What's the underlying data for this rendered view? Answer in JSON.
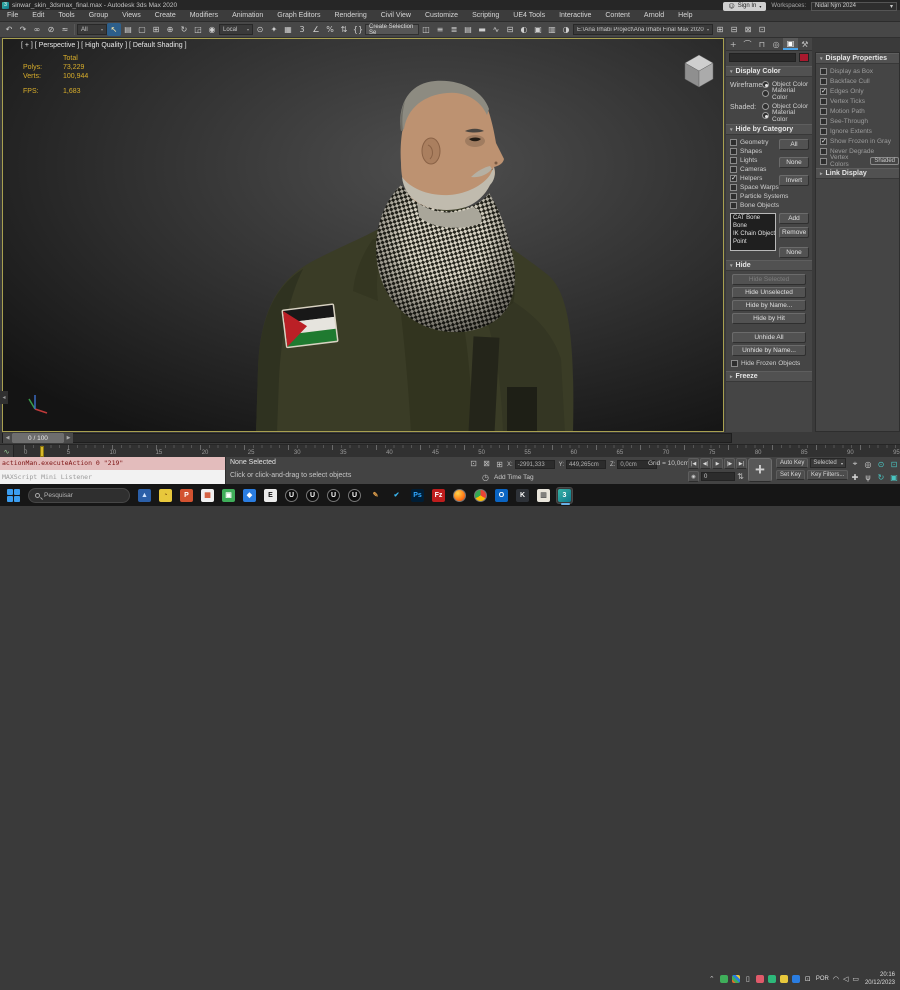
{
  "window": {
    "title": "sinwar_skin_3dsmax_final.max - Autodesk 3ds Max 2020",
    "app_glyph": "3",
    "minimize_glyph": "—",
    "maximize_glyph": "▢",
    "close_glyph": "✕"
  },
  "menubar": {
    "items": [
      "File",
      "Edit",
      "Tools",
      "Group",
      "Views",
      "Create",
      "Modifiers",
      "Animation",
      "Graph Editors",
      "Rendering",
      "Civil View",
      "Customize",
      "Scripting",
      "UE4 Tools",
      "Interactive",
      "Content",
      "Arnold",
      "Help"
    ],
    "sign_in": "Sign In",
    "workspaces_label": "Workspaces:",
    "workspace_value": "Nidal Njm 2024"
  },
  "toolbar": {
    "strip_a": [
      {
        "name": "undo-icon",
        "glyph": "↶"
      },
      {
        "name": "redo-icon",
        "glyph": "↷"
      },
      {
        "name": "select-and-link-icon",
        "glyph": "∞"
      },
      {
        "name": "unlink-selection-icon",
        "glyph": "⊘"
      },
      {
        "name": "bind-to-space-warp-icon",
        "glyph": "≈"
      }
    ],
    "filter_value": "All",
    "strip_b": [
      {
        "name": "select-object-icon",
        "glyph": "↖",
        "active": true
      },
      {
        "name": "select-by-name-icon",
        "glyph": "▤"
      },
      {
        "name": "rectangular-selection-region-icon",
        "glyph": "▢"
      },
      {
        "name": "window-crossing-icon",
        "glyph": "⊞"
      },
      {
        "name": "select-and-move-icon",
        "glyph": "⊕"
      },
      {
        "name": "select-and-rotate-icon",
        "glyph": "↻"
      },
      {
        "name": "select-and-scale-icon",
        "glyph": "◲"
      },
      {
        "name": "select-and-place-icon",
        "glyph": "◉"
      }
    ],
    "coord_value": "Local",
    "strip_c": [
      {
        "name": "use-pivot-point-icon",
        "glyph": "⊙"
      },
      {
        "name": "select-and-manipulate-icon",
        "glyph": "✦"
      },
      {
        "name": "keyboard-shortcut-override-icon",
        "glyph": "▦"
      },
      {
        "name": "snap-toggle-3d-icon",
        "glyph": "3"
      },
      {
        "name": "angle-snap-icon",
        "glyph": "∠"
      },
      {
        "name": "percent-snap-icon",
        "glyph": "%"
      },
      {
        "name": "spinner-snap-icon",
        "glyph": "⇅"
      },
      {
        "name": "edit-named-selection-sets-icon",
        "glyph": "{}"
      }
    ],
    "selection_set_value": "Create Selection Se",
    "strip_d": [
      {
        "name": "mirror-icon",
        "glyph": "◫"
      },
      {
        "name": "align-icon",
        "glyph": "≡"
      },
      {
        "name": "layer-manager-icon",
        "glyph": "≣"
      },
      {
        "name": "toggle-layer-explorer-icon",
        "glyph": "▤"
      },
      {
        "name": "toggle-ribbon-icon",
        "glyph": "▬"
      },
      {
        "name": "curve-editor-icon",
        "glyph": "∿"
      },
      {
        "name": "schematic-view-icon",
        "glyph": "⊟"
      },
      {
        "name": "material-editor-icon",
        "glyph": "◐"
      },
      {
        "name": "render-setup-icon",
        "glyph": "▣"
      },
      {
        "name": "rendered-frame-window-icon",
        "glyph": "▥"
      },
      {
        "name": "render-production-icon",
        "glyph": "◑"
      }
    ],
    "project_path": "E:\\Ana Irhabi Project\\Ana Irhabi Final Max 2020",
    "strip_e": [
      {
        "name": "scene-tool-icon-1",
        "glyph": "⊞"
      },
      {
        "name": "scene-tool-icon-2",
        "glyph": "⊟"
      },
      {
        "name": "scene-tool-icon-3",
        "glyph": "⊠"
      },
      {
        "name": "scene-tool-icon-4",
        "glyph": "⊡"
      }
    ]
  },
  "viewport": {
    "label": "[ + ] [ Perspective ] [ High Quality ] [ Default Shading ]",
    "total_label": "Total",
    "polys_label": "Polys:",
    "polys_value": "73,229",
    "verts_label": "Verts:",
    "verts_value": "100,944",
    "fps_label": "FPS:",
    "fps_value": "1,683"
  },
  "command_panel": {
    "tabs": [
      {
        "name": "create-tab",
        "glyph": "+"
      },
      {
        "name": "modify-tab",
        "glyph": "⌒"
      },
      {
        "name": "hierarchy-tab",
        "glyph": "⊓"
      },
      {
        "name": "motion-tab",
        "glyph": "◎"
      },
      {
        "name": "display-tab",
        "glyph": "▣",
        "active": true
      },
      {
        "name": "utilities-tab",
        "glyph": "⚒"
      }
    ],
    "object_name_value": "",
    "color_swatch": "#a8192e",
    "display_color": {
      "title": "Display Color",
      "rows": [
        {
          "label": "Wireframe:",
          "opt1": "Object Color",
          "opt1_on": true,
          "opt2": "Material Color",
          "opt2_on": false
        },
        {
          "label": "Shaded:",
          "opt1": "Object Color",
          "opt1_on": false,
          "opt2": "Material Color",
          "opt2_on": true
        }
      ]
    },
    "hide_by_category": {
      "title": "Hide by Category",
      "categories": [
        {
          "label": "Geometry",
          "checked": false
        },
        {
          "label": "Shapes",
          "checked": false
        },
        {
          "label": "Lights",
          "checked": false
        },
        {
          "label": "Cameras",
          "checked": false
        },
        {
          "label": "Helpers",
          "checked": true
        },
        {
          "label": "Space Warps",
          "checked": false
        },
        {
          "label": "Particle Systems",
          "checked": false
        },
        {
          "label": "Bone Objects",
          "checked": false
        }
      ],
      "quick_buttons": [
        "All",
        "None",
        "Invert"
      ],
      "list_items": [
        "CAT Bone",
        "Bone",
        "IK Chain Object",
        "Point"
      ],
      "list_buttons": [
        "Add",
        "Remove",
        "None"
      ]
    },
    "hide": {
      "title": "Hide",
      "buttons": [
        {
          "label": "Hide Selected",
          "disabled": true
        },
        {
          "label": "Hide Unselected"
        },
        {
          "label": "Hide by Name..."
        },
        {
          "label": "Hide by Hit"
        },
        {
          "label": "Unhide All",
          "gap": true
        },
        {
          "label": "Unhide by Name..."
        }
      ],
      "checkbox_label": "Hide Frozen Objects",
      "checkbox_checked": false
    },
    "freeze_title": "Freeze"
  },
  "display_properties": {
    "title": "Display Properties",
    "items": [
      {
        "label": "Display as Box",
        "checked": false
      },
      {
        "label": "Backface Cull",
        "checked": false
      },
      {
        "label": "Edges Only",
        "checked": true
      },
      {
        "label": "Vertex Ticks",
        "checked": false
      },
      {
        "label": "Motion Path",
        "checked": false
      },
      {
        "label": "See-Through",
        "checked": false
      },
      {
        "label": "Ignore Extents",
        "checked": false
      },
      {
        "label": "Show Frozen in Gray",
        "checked": true
      },
      {
        "label": "Never Degrade",
        "checked": false
      },
      {
        "label": "Vertex Colors",
        "checked": false,
        "button": "Shaded"
      }
    ],
    "link_display_title": "Link Display"
  },
  "timeline": {
    "slider_value": "0 / 100",
    "prev_glyph": "◀",
    "next_glyph": "▶",
    "curve_editor_glyph": "∿",
    "tick_labels": [
      "0",
      "5",
      "10",
      "15",
      "20",
      "25",
      "30",
      "35",
      "40",
      "45",
      "50",
      "55",
      "60",
      "65",
      "70",
      "75",
      "80",
      "85",
      "90",
      "95"
    ]
  },
  "statusbar": {
    "maxscript_line": "actionMan.executeAction 0 \"219\"",
    "listener_label": "MAXScript Mini Listener",
    "selection_status": "None Selected",
    "prompt": "Click or click-and-drag to select objects",
    "toggles": [
      {
        "name": "isolate-selection-toggle",
        "glyph": "⊡"
      },
      {
        "name": "selection-lock-toggle",
        "glyph": "⊠"
      }
    ],
    "coord_icon_glyph": "⊞",
    "coords": [
      {
        "label": "X:",
        "value": "-2991,333"
      },
      {
        "label": "Y:",
        "value": "449,265cm"
      },
      {
        "label": "Z:",
        "value": "0,0cm"
      }
    ],
    "grid_label": "Grid = 10,0cm",
    "time_tag_icon_glyph": "◷",
    "add_time_tag": "Add Time Tag",
    "playback": [
      {
        "name": "go-to-start-button",
        "glyph": "|◀"
      },
      {
        "name": "previous-frame-button",
        "glyph": "◀|"
      },
      {
        "name": "play-button",
        "glyph": "▶"
      },
      {
        "name": "next-frame-button",
        "glyph": "|▶"
      },
      {
        "name": "go-to-end-button",
        "glyph": "▶|"
      }
    ],
    "key_mode_glyph": "◉",
    "frame_value": "0",
    "spinner_glyph": "⇅",
    "key_icon_glyph": "⚷",
    "bigkey_glyph": "+",
    "auto_key": "Auto Key",
    "selected_dd": "Selected",
    "set_key": "Set Key",
    "key_filters": "Key Filters...",
    "nav_icons": [
      {
        "name": "zoom-button",
        "glyph": "⌖"
      },
      {
        "name": "zoom-all-button",
        "glyph": "◎"
      },
      {
        "name": "zoom-extents-button",
        "glyph": "⊙",
        "fg": "#49c6c2"
      },
      {
        "name": "zoom-region-button",
        "glyph": "⊡",
        "fg": "#49c6c2"
      },
      {
        "name": "pan-button",
        "glyph": "✚"
      },
      {
        "name": "walk-through-button",
        "glyph": "ψ"
      },
      {
        "name": "orbit-button",
        "glyph": "↻",
        "fg": "#49c6c2"
      },
      {
        "name": "maximize-viewport-button",
        "glyph": "▣",
        "fg": "#49c6c2"
      }
    ]
  },
  "taskbar": {
    "search_placeholder": "Pesquisar",
    "apps": [
      {
        "name": "photos-app-icon",
        "glyph": "▲",
        "bg": "#2b5fa8",
        "fg": "#cfe3ff"
      },
      {
        "name": "paint-app-icon",
        "glyph": "◔",
        "bg": "#e8c83c",
        "fg": "#8a5a10"
      },
      {
        "name": "powerpoint-app-icon",
        "glyph": "P",
        "bg": "#d35230",
        "fg": "#ffffff"
      },
      {
        "name": "office-tiles-app-icon",
        "glyph": "▦",
        "bg": "#f0f0f0",
        "fg": "#d35230"
      },
      {
        "name": "gallery-app-icon",
        "glyph": "▣",
        "bg": "#3fae5a",
        "fg": "#ffffff"
      },
      {
        "name": "hexagon-app-icon",
        "glyph": "◆",
        "bg": "#2a7de1",
        "fg": "#ffffff"
      },
      {
        "name": "epic-games-icon",
        "glyph": "E",
        "bg": "#ececec",
        "fg": "#111111"
      },
      {
        "name": "unreal-engine-icon",
        "glyph": "U",
        "bg": "#0d0d0d",
        "fg": "#ffffff",
        "round": true
      },
      {
        "name": "unreal-engine-icon",
        "glyph": "U",
        "bg": "#0d0d0d",
        "fg": "#ffffff",
        "round": true
      },
      {
        "name": "unreal-engine-icon",
        "glyph": "U",
        "bg": "#0d0d0d",
        "fg": "#ffffff",
        "round": true
      },
      {
        "name": "unreal-engine-icon",
        "glyph": "U",
        "bg": "#0d0d0d",
        "fg": "#ffffff",
        "round": true
      },
      {
        "name": "pen-tool-icon",
        "glyph": "✎",
        "bg": "transparent",
        "fg": "#d89a4a"
      },
      {
        "name": "check-app-icon",
        "glyph": "✔",
        "bg": "transparent",
        "fg": "#3ab6f0"
      },
      {
        "name": "photoshop-icon",
        "glyph": "Ps",
        "bg": "#001e36",
        "fg": "#31a8ff"
      },
      {
        "name": "filezilla-icon",
        "glyph": "Fz",
        "bg": "#bf1d1d",
        "fg": "#ffffff"
      },
      {
        "name": "firefox-icon",
        "glyph": "",
        "bg": "radial-gradient(circle at 35% 30%,#ffd54a,#ff7a18 60%,#e0390b)",
        "fg": "#ffffff",
        "round": true
      },
      {
        "name": "chrome-icon",
        "glyph": "",
        "bg": "conic-gradient(#ea4335 0deg 120deg,#fbbc05 120deg 240deg,#34a853 240deg 360deg)",
        "fg": "#ffffff",
        "round": true
      },
      {
        "name": "outlook-icon",
        "glyph": "O",
        "bg": "#0a64c2",
        "fg": "#ffffff"
      },
      {
        "name": "krita-app-icon",
        "glyph": "K",
        "bg": "#2e3238",
        "fg": "#ffffff"
      },
      {
        "name": "notes-app-icon",
        "glyph": "▥",
        "bg": "#e8e4da",
        "fg": "#555555"
      },
      {
        "name": "3dsmax-icon",
        "glyph": "3",
        "bg": "linear-gradient(135deg,#38b2a5,#0f7a8d)",
        "fg": "#ffffff",
        "active": true
      }
    ],
    "tray": [
      {
        "name": "tray-chevron-icon",
        "glyph": "⌃",
        "fg": "#cccccc"
      },
      {
        "name": "tray-green-app-icon",
        "glyph": "",
        "bg": "#3fae5a"
      },
      {
        "name": "tray-mosaic-app-icon",
        "glyph": "",
        "bg": "linear-gradient(45deg,#e06a2a 0 25%,#3fae5a 0 50%,#2a7de1 0 75%,#e8c83c 0)"
      },
      {
        "name": "phone-link-icon",
        "glyph": "▯",
        "fg": "#dddddd"
      },
      {
        "name": "tray-red-app-icon",
        "glyph": "",
        "bg": "#e05a6a"
      },
      {
        "name": "tray-sync-app-icon",
        "glyph": "",
        "bg": "#2db87a"
      },
      {
        "name": "tray-yellow-app-icon",
        "glyph": "",
        "bg": "#e8c83c"
      },
      {
        "name": "bluetooth-icon",
        "glyph": "",
        "bg": "#2a7de1"
      },
      {
        "name": "display-device-icon",
        "glyph": "⊡",
        "fg": "#dddddd"
      }
    ],
    "language": "POR",
    "wifi_glyph": "◠",
    "volume_glyph": "◁",
    "battery_glyph": "▭",
    "time": "20:16",
    "date": "20/12/2023"
  }
}
